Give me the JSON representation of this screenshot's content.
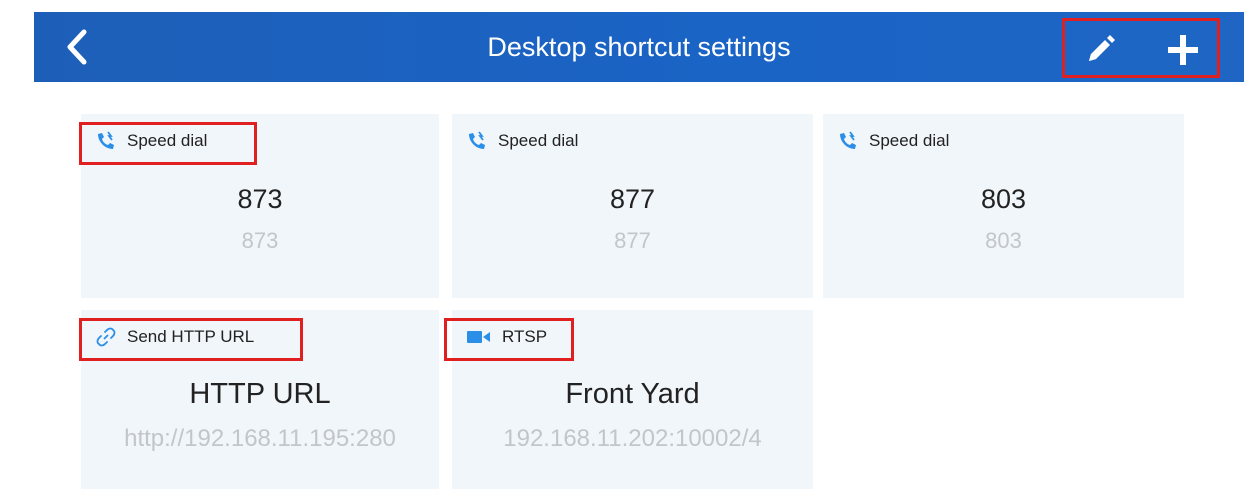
{
  "header": {
    "title": "Desktop shortcut settings",
    "back_icon": "chevron-left-icon",
    "edit_icon": "pencil-icon",
    "add_icon": "plus-icon",
    "color": "#1a64c6"
  },
  "shortcuts": [
    {
      "type": "Speed dial",
      "icon": "speed-dial-icon",
      "name": "873",
      "value": "873",
      "highlighted": true
    },
    {
      "type": "Speed dial",
      "icon": "speed-dial-icon",
      "name": "877",
      "value": "877",
      "highlighted": false
    },
    {
      "type": "Speed dial",
      "icon": "speed-dial-icon",
      "name": "803",
      "value": "803",
      "highlighted": false
    },
    {
      "type": "Send HTTP URL",
      "icon": "link-icon",
      "name": "HTTP URL",
      "value": "http://192.168.11.195:280",
      "highlighted": true
    },
    {
      "type": "RTSP",
      "icon": "video-camera-icon",
      "name": "Front Yard",
      "value": "192.168.11.202:10002/4",
      "highlighted": true
    }
  ],
  "colors": {
    "accent": "#2b8fe8",
    "highlight": "#e02020",
    "card_bg": "#f1f6fb"
  }
}
